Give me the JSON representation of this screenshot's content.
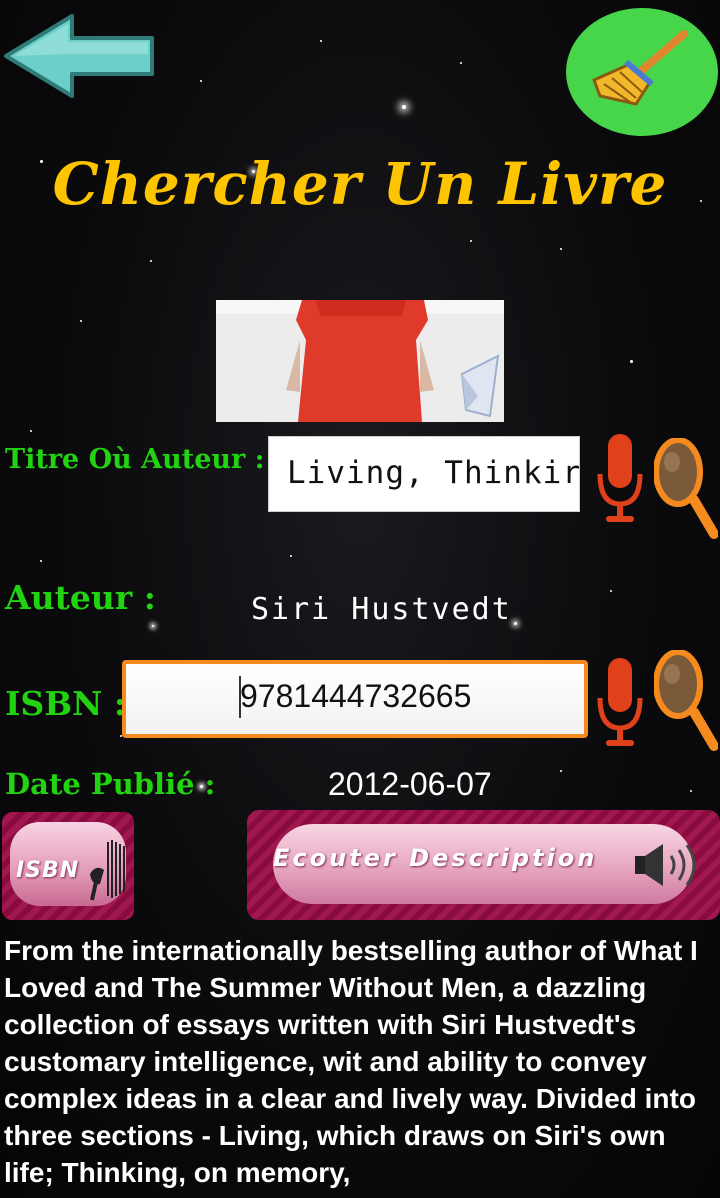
{
  "header": {
    "title": "Chercher Un Livre",
    "back_icon": "back-arrow-icon",
    "clear_icon": "broom-icon"
  },
  "form": {
    "title_author_label": "Titre Où Auteur :",
    "title_author_value": "Living, Thinkir",
    "author_label": "Auteur :",
    "author_value": "Siri Hustvedt",
    "isbn_label": "ISBN :",
    "isbn_value": "9781444732665",
    "date_label": "Date Publié :",
    "date_value": "2012-06-07"
  },
  "actions": {
    "isbn_scan_label": "ISBN",
    "listen_description_label": "Ecouter Description"
  },
  "description": "From the internationally bestselling author of What I Loved and The Summer Without Men, a dazzling collection of essays written with Siri Hustvedt's customary intelligence, wit and ability to convey complex ideas in a clear and lively way. Divided into three sections - Living, which draws on Siri's own life; Thinking, on memory,",
  "colors": {
    "title": "#ffc400",
    "label": "#22d311",
    "accent_orange": "#f58a1f",
    "mic": "#e0401a",
    "button_magenta": "#9a1548",
    "clear_circle": "#47d64a",
    "arrow": "#6ccfc9"
  }
}
